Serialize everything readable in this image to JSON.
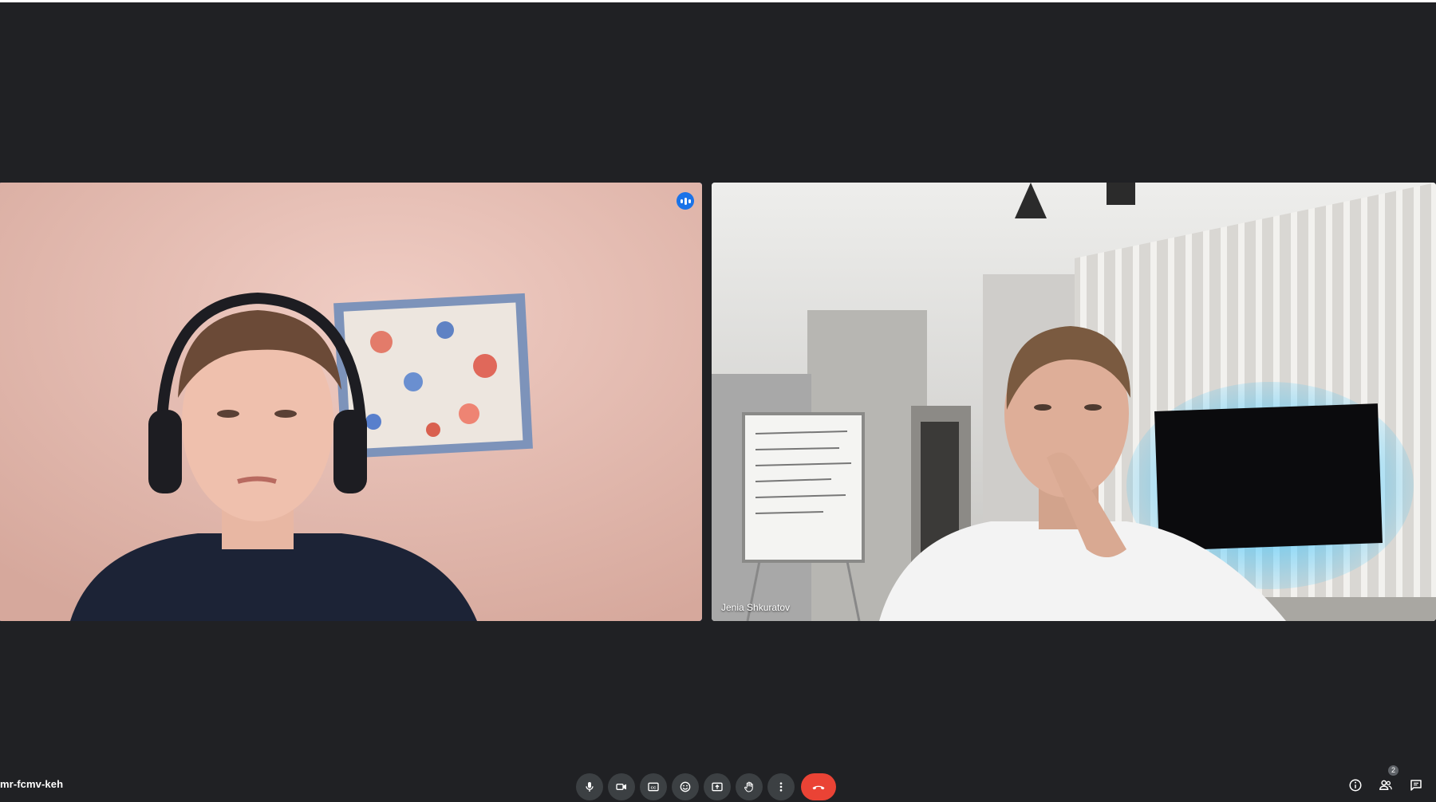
{
  "meeting": {
    "code": "mr-fcmv-keh"
  },
  "participants": [
    {
      "name": "",
      "speaking": true
    },
    {
      "name": "Jenia Shkuratov",
      "speaking": false
    }
  ],
  "controls": [
    {
      "icon": "microphone-icon"
    },
    {
      "icon": "camera-icon"
    },
    {
      "icon": "captions-icon"
    },
    {
      "icon": "emoji-icon"
    },
    {
      "icon": "present-screen-icon"
    },
    {
      "icon": "raise-hand-icon"
    },
    {
      "icon": "more-options-icon"
    },
    {
      "icon": "end-call-icon"
    }
  ],
  "right_tools": {
    "people_count": "2"
  },
  "colors": {
    "background": "#202124",
    "active_speaker_border": "#6d99f2",
    "end_call": "#ea4335",
    "control_bg": "#3c4043"
  }
}
